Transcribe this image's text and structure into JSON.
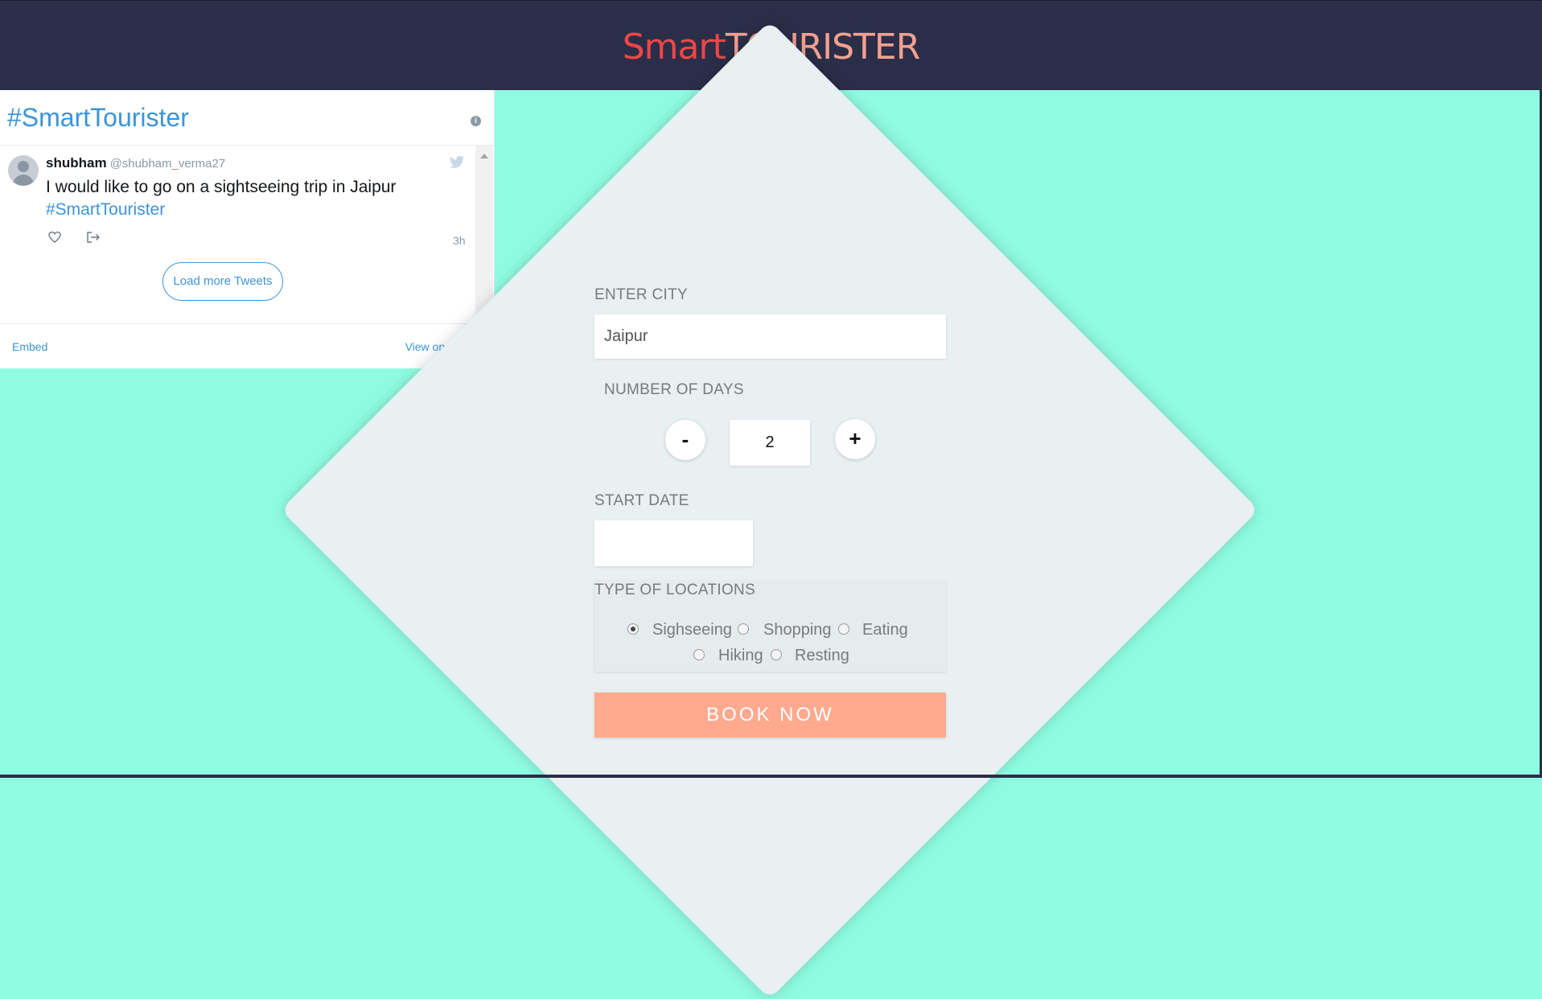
{
  "header": {
    "brand_part1": "Smart",
    "brand_part2": "TOURISTER"
  },
  "twitter_widget": {
    "title": "#SmartTourister",
    "tweet": {
      "name": "shubham",
      "handle": "@shubham_verma27",
      "text": "I would like to go on a sightseeing trip in Jaipur",
      "hashtag": "#SmartTourister",
      "time": "3h"
    },
    "load_more_label": "Load more Tweets",
    "embed_label": "Embed",
    "view_label": "View on Twitter"
  },
  "form": {
    "city_label": "ENTER CITY",
    "city_value": "Jaipur",
    "days_label": "NUMBER OF DAYS",
    "minus_label": "-",
    "plus_label": "+",
    "days_value": "2",
    "start_date_label": "START DATE",
    "start_date_value": "",
    "locations_label": "TYPE OF LOCATIONS",
    "locations": [
      {
        "label": "Sighseeing",
        "checked": true
      },
      {
        "label": "Shopping",
        "checked": false
      },
      {
        "label": "Eating",
        "checked": false
      },
      {
        "label": "Hiking",
        "checked": false
      },
      {
        "label": "Resting",
        "checked": false
      }
    ],
    "book_label": "BOOK NOW"
  },
  "colors": {
    "background": "#8ffce2",
    "header": "#2a2e48",
    "brand_smart": "#ee4747",
    "brand_tourister": "#f4a091",
    "book_button": "#ffa98f",
    "twitter_blue": "#3b94d9"
  }
}
